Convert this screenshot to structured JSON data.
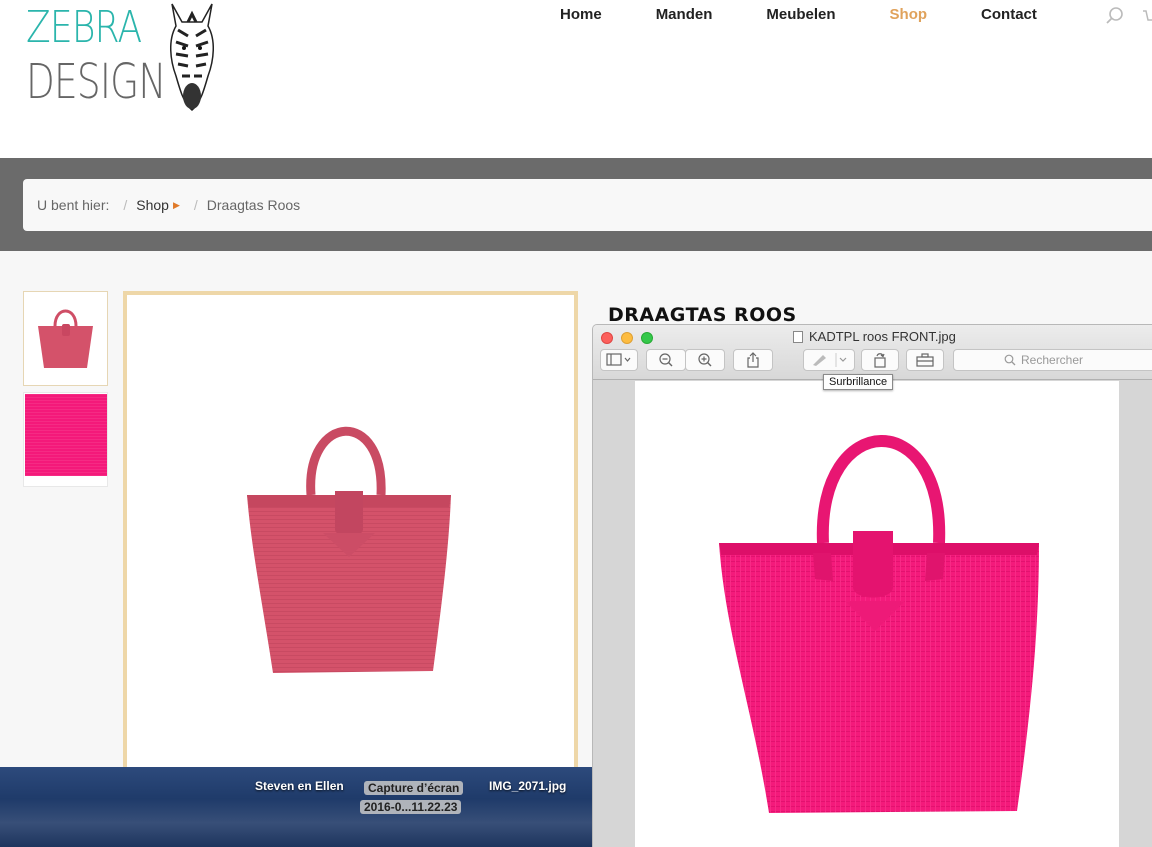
{
  "logo": {
    "line1": "ZEBRA",
    "line2": "DESIGN"
  },
  "nav": {
    "items": [
      "Home",
      "Manden",
      "Meubelen",
      "Shop",
      "Contact"
    ],
    "active": "Shop"
  },
  "breadcrumb": {
    "prefix": "U bent hier:",
    "link": "Shop",
    "current": "Draagtas Roos"
  },
  "product": {
    "title": "DRAAGTAS ROOS"
  },
  "preview_window": {
    "title": "KADTPL roos FRONT.jpg",
    "search_placeholder": "Rechercher",
    "tooltip": "Surbrillance"
  },
  "desktop": {
    "items": [
      {
        "label": "Steven en Ellen"
      },
      {
        "label": "Capture d’écran",
        "sublabel": "2016-0...11.22.23"
      },
      {
        "label": "IMG_2071.jpg"
      }
    ]
  },
  "colors": {
    "accent": "#e0a25b",
    "teal": "#2bb5ac",
    "bag_muted": "#d4526a",
    "bag_pink": "#f4197a"
  }
}
